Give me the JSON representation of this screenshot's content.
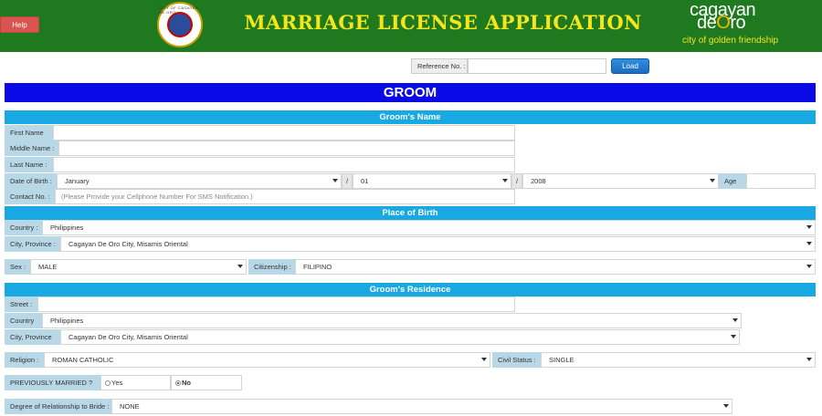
{
  "header": {
    "help_label": "Help",
    "title": "MARRIAGE LICENSE APPLICATION",
    "seal_text": "CITY OF CAGAYAN DE ORO",
    "city_logo": {
      "line1": "cagayan",
      "line2a": "de",
      "line2o": "O",
      "line2b": "ro",
      "tagline": "city of golden friendship"
    }
  },
  "reference": {
    "label": "Reference No. :",
    "value": "",
    "load_label": "Load"
  },
  "main_title": "GROOM",
  "sections": {
    "name": "Groom's Name",
    "birth": "Place of Birth",
    "residence": "Groom's Residence"
  },
  "name": {
    "first_label": "First Name",
    "first_value": "",
    "middle_label": "Middle Name :",
    "middle_value": "",
    "last_label": "Last Name :",
    "last_value": "",
    "dob_label": "Date of Birth :",
    "dob_month": "January",
    "dob_sep1": "/",
    "dob_day": "01",
    "dob_sep2": "/",
    "dob_year": "2008",
    "age_label": "Age",
    "age_value": "",
    "contact_label": "Contact No. :",
    "contact_placeholder": "(Please Provide your Cellphone Number For SMS Notification.)"
  },
  "birth": {
    "country_label": "Country :",
    "country_value": "Philippines",
    "city_label": "City, Province :",
    "city_value": "Cagayan De Oro City, Misamis Oriental"
  },
  "sex_row": {
    "sex_label": "Sex :",
    "sex_value": "MALE",
    "citizenship_label": "Citizenship :",
    "citizenship_value": "FILIPINO"
  },
  "residence": {
    "street_label": "Street :",
    "street_value": "",
    "country_label": "Country",
    "country_value": "Philippines",
    "city_label": "City, Province",
    "city_value": "Cagayan De Oro City, Misamis Oriental"
  },
  "status_row": {
    "religion_label": "Religion :",
    "religion_value": "ROMAN CATHOLIC",
    "civil_label": "Civil Status :",
    "civil_value": "SINGLE"
  },
  "married": {
    "label": "PREVIOUSLY MARRIED ?",
    "yes": "Yes",
    "no": "No",
    "selected": "No"
  },
  "relationship": {
    "label": "Degree of Relationship to Bride :",
    "value": "NONE"
  },
  "colors": {
    "header_green": "#1f7a1f",
    "title_yellow": "#f4e61a",
    "main_bar": "#0a0ae6",
    "section_bar": "#18a8e2",
    "label_bg": "#b8d8e8",
    "help_red": "#d9534f"
  }
}
